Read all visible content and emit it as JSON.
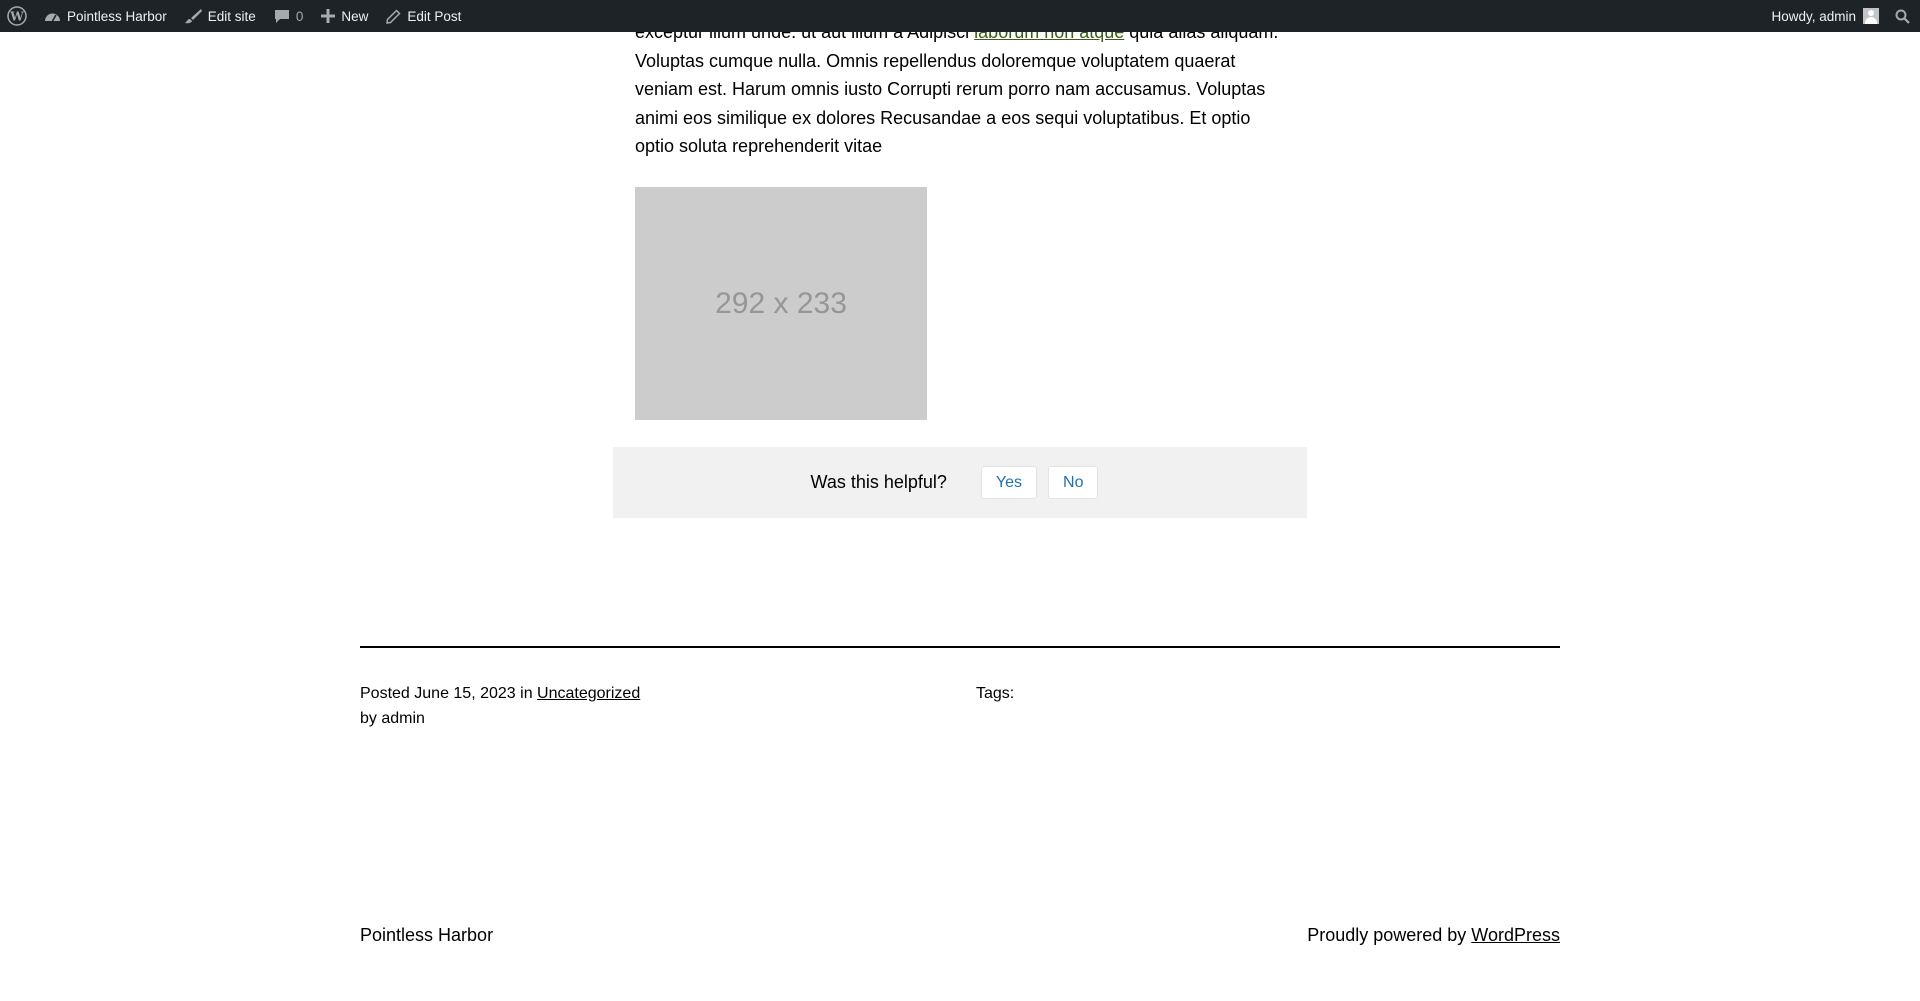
{
  "adminbar": {
    "site_name": "Pointless Harbor",
    "edit_site": "Edit site",
    "comments_count": "0",
    "new": "New",
    "edit_post": "Edit Post",
    "howdy": "Howdy, admin"
  },
  "article": {
    "line1_before": "exceptur illum unde. ut aut illum a Adipisci ",
    "line1_link": "laborum non atque",
    "line1_after": " quia alias aliquam.",
    "text_rest": "Voluptas cumque nulla. Omnis repellendus doloremque voluptatem quaerat veniam est. Harum omnis iusto Corrupti rerum porro nam accusamus. Voluptas animi eos similique ex dolores Recusandae a eos sequi voluptatibus. Et optio optio soluta reprehenderit vitae",
    "image_label": "292 x 233"
  },
  "feedback": {
    "question": "Was this helpful?",
    "yes": "Yes",
    "no": "No"
  },
  "post_meta": {
    "posted": "Posted",
    "date": "June 15, 2023",
    "in": "in",
    "category": "Uncategorized",
    "by": "by",
    "author": "admin",
    "tags_label": "Tags:"
  },
  "footer": {
    "site_title": "Pointless Harbor",
    "powered_text": "Proudly powered by ",
    "powered_link": "WordPress"
  },
  "colors": {
    "adminbar_bg": "#1d2327",
    "link_green": "#3a5a1a",
    "button_blue": "#2271b1"
  }
}
